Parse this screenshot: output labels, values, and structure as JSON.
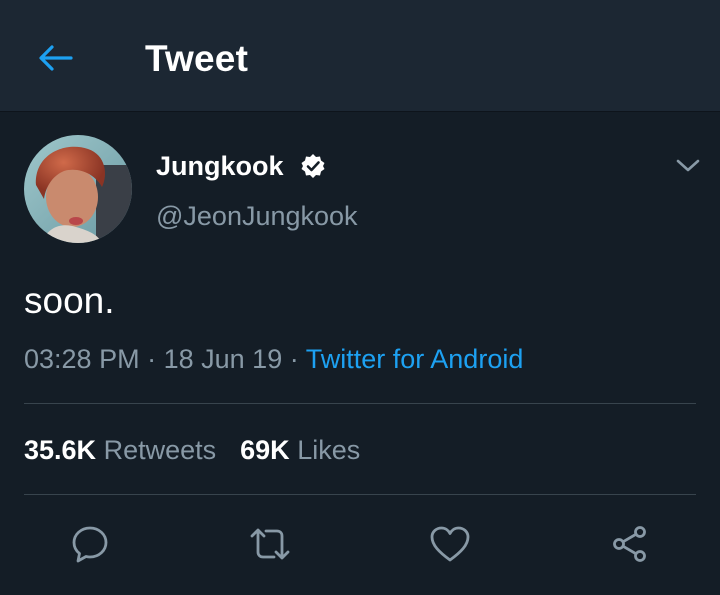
{
  "header": {
    "title": "Tweet"
  },
  "author": {
    "name": "Jungkook",
    "handle": "@JeonJungkook",
    "verified": true
  },
  "tweet": {
    "text": "soon.",
    "time": "03:28 PM",
    "date": "18 Jun 19",
    "separator": "·",
    "source": "Twitter for Android"
  },
  "stats": {
    "retweets_count": "35.6K",
    "retweets_label": "Retweets",
    "likes_count": "69K",
    "likes_label": "Likes"
  },
  "icons": {
    "back": "back-arrow-icon",
    "verified": "verified-badge-icon",
    "more": "chevron-down-icon",
    "reply": "reply-icon",
    "retweet": "retweet-icon",
    "like": "heart-icon",
    "share": "share-icon"
  },
  "colors": {
    "background": "#141d26",
    "header": "#1c2733",
    "accent": "#1da1f2",
    "secondary_text": "#8899a6",
    "divider": "#38444d"
  }
}
